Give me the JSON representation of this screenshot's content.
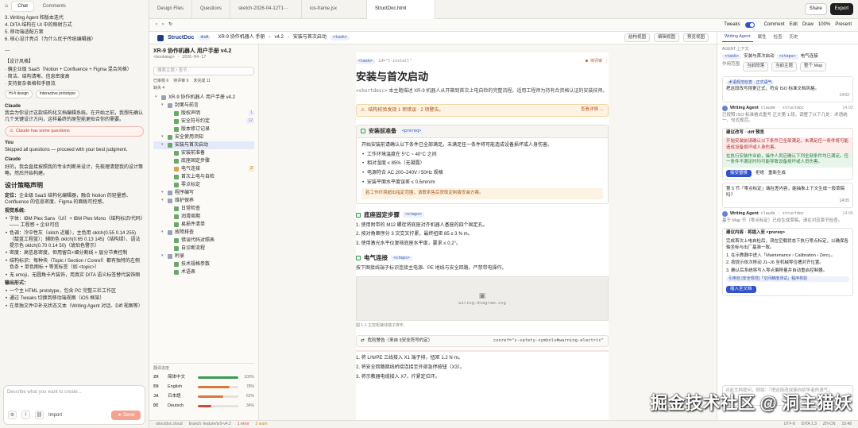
{
  "chat": {
    "tabs": [
      "Chat",
      "Comments"
    ],
    "lines_top": [
      "3. Writing Agent 和版本迭代",
      "4. DITA 结构在 UI 中的映射方式",
      "5. 移动端适配方案",
      "6. 核心设计亮点（为什么优于传统编辑器）"
    ],
    "ellipsis": "---",
    "style_title": "【设计风格】",
    "style_items": [
      "· 偏企业级 SaaS（Notion + Confluence + Figma 混合风格）",
      "· 简洁、结构清晰、信息密度高",
      "· 支持复杂表格和手册流"
    ],
    "chips": [
      "Hi-fi design",
      "Interactive prototype"
    ],
    "claude_label": "Claude",
    "claude_text": "我会为你设计这款结构化文档编辑系统。在开始之前，我想先确认几个关键设计方向，这样最终的原型能更贴合你的需要。",
    "warn_chip": "Claude has some questions",
    "you_label": "You",
    "you_text": "Skipped all questions — proceed with your best judgment.",
    "claude2_label": "Claude",
    "claude2_text": "好的，我会直接按照我的专业判断来设计，先梳理清楚我的设计策略，然后开始构建。",
    "h_strategy": "设计策略声明",
    "pos_label": "定位：",
    "pos_text": "企业级 SaaS 结构化编辑器，融合 Notion 的轻量感、Confluence 的信息密度、Figma 的面板可控感。",
    "visual_label": "视觉系统:",
    "visual_items": [
      "字体：IBM Plex Sans（UI）+ IBM Plex Mono（结构标识/代码）—— 工程感 + 企业可信",
      "色调：冷中性灰（oklch 近暖），主色用 oklch(0.55 0.14 255)（靛蓝工程蓝）；辅助色 oklch(0.65 0.13 145)（结构绿）、语法提示色 oklch(0.70 0.14 50)（琥珀色警示）",
      "密度：高信息密度，但用留白+细分割线 + 层分节奏控制",
      "结构标识：每种块（Topic / Section / Conref）都有独特的左侧色条 + 单色图标 + 等宽标签（如 <topic>）",
      "无 emoji，无圆角卡片装饰，用真实 DITA 语义标签替代装饰图"
    ],
    "h_output": "输出形式：",
    "output_items": [
      "一个主 HTML prototype，包含 PC 完整三栏工作区",
      "通过 Tweaks 切换到移动端视图（iOS 框架）",
      "在单独文件中补充状态文本（Writing Agent 对话、Diff 视图等）"
    ],
    "compose_placeholder": "Describe what you want to create...",
    "import_label": "Import",
    "send_label": "Send"
  },
  "topbar": {
    "tabs": [
      "Design Files",
      "Questions",
      "sketch-2026-04-12T1···",
      "ios-frame.jsx",
      "StructDoc.html"
    ],
    "active_tab": "StructDoc.html",
    "tweaks_label": "Tweaks",
    "comment_label": "Comment",
    "edit_label": "Edit",
    "draw_label": "Draw",
    "zoom": "100%",
    "present_label": "Present",
    "share_label": "Share",
    "export_label": "Export"
  },
  "header": {
    "brand": "StructDoc",
    "brand_tag": "draft",
    "crumbs": [
      "XR-9 协作机器人 手册",
      "v4.2",
      "安装与首次启动"
    ],
    "crumb_tag": "<task>",
    "btns": [
      "结构视图",
      "编辑视图",
      "预览视图"
    ],
    "zh_label": "ZH · 50%",
    "save_label": "发布"
  },
  "tree": {
    "title": "XR-9 协作机器人 用户手册 v4.2",
    "subtitle": "<bookmap> · 2026-04-17",
    "search_placeholder": "搜索主题 / 查节...",
    "stats": [
      "已审核 6",
      "待评审 9",
      "未完成 11",
      "缺失 4"
    ],
    "nodes": [
      {
        "label": "XR-9 协作机器人 用户手册 v4.2",
        "lvl": 0,
        "ic": "gr"
      },
      {
        "label": "封面与前言",
        "lvl": 1,
        "ic": "gr"
      },
      {
        "label": "版权声明",
        "lvl": 2,
        "ic": "g",
        "cnt": "1"
      },
      {
        "label": "安全符号约定",
        "lvl": 2,
        "ic": "g",
        "cnt": "12"
      },
      {
        "label": "版本修订记录",
        "lvl": 2,
        "ic": "g"
      },
      {
        "label": "安全使用须知",
        "lvl": 1,
        "ic": "g"
      },
      {
        "label": "安装与首次启动",
        "lvl": 1,
        "ic": "g",
        "sel": true
      },
      {
        "label": "安装前准备",
        "lvl": 2,
        "ic": "g"
      },
      {
        "label": "底座固定步骤",
        "lvl": 2,
        "ic": "g"
      },
      {
        "label": "电气连接",
        "lvl": 2,
        "ic": "y",
        "cnt": "2",
        "warn": true
      },
      {
        "label": "首次上电与自检",
        "lvl": 2,
        "ic": "g"
      },
      {
        "label": "零点标定",
        "lvl": 2,
        "ic": "g"
      },
      {
        "label": "程序编写",
        "lvl": 1,
        "ic": "gr"
      },
      {
        "label": "维护保养",
        "lvl": 1,
        "ic": "gr"
      },
      {
        "label": "日常检查",
        "lvl": 2,
        "ic": "g"
      },
      {
        "label": "润滑周期",
        "lvl": 2,
        "ic": "g"
      },
      {
        "label": "易损件清单",
        "lvl": 2,
        "ic": "g"
      },
      {
        "label": "故障排查",
        "lvl": 1,
        "ic": "gr"
      },
      {
        "label": "错误代码对照表",
        "lvl": 2,
        "ic": "g"
      },
      {
        "label": "自诊断流程",
        "lvl": 2,
        "ic": "g"
      },
      {
        "label": "附录",
        "lvl": 1,
        "ic": "gr"
      },
      {
        "label": "技术规格参数",
        "lvl": 2,
        "ic": "g"
      },
      {
        "label": "术语表",
        "lvl": 2,
        "ic": "g"
      }
    ],
    "lang_title": "翻译进度",
    "langs": [
      {
        "code": "ZH",
        "name": "简体中文",
        "pct": 100,
        "num": "100%",
        "color": "#3b9a53"
      },
      {
        "code": "EN",
        "name": "English",
        "pct": 78,
        "num": "78%",
        "color": "#d57a3a"
      },
      {
        "code": "JA",
        "name": "日本語",
        "pct": 62,
        "num": "62%",
        "color": "#d57a3a"
      },
      {
        "code": "DE",
        "name": "Deutsch",
        "pct": 34,
        "num": "34%",
        "color": "#c94a3a"
      }
    ]
  },
  "doc": {
    "tag": "<task>",
    "id": "id=\"t-install\"",
    "status": "● 待评审 ⋮",
    "title": "安装与首次启动",
    "lead_tag": "<shortdesc>",
    "lead": "本主题描述 XR-9 机器人从开箱到首次上电自检的完整流程。适用工程师为持有合资格认证的安装技师。",
    "alert": "结构校验发现 1 项错误 · 2 项警告。",
    "alert_link": "查看详情 →",
    "card1_title": "安装前准备",
    "card1_tag": "<prereq>",
    "card1_lead": "开始安装前请确认以下条件已全部满足。未满足任一条件将可能造成设备损坏或人身伤害。",
    "card1_items": [
      "工作环境温度在 5°C ~ 40°C 之间",
      "相对湿度 ≤ 85%（无凝露）",
      "电源符合 AC 200–240V / 50Hz 规格",
      "安装平面水平度误差 ≤ 0.5mm/m"
    ],
    "card1_note": "若工作环境超出指定范围，请联系售后获取定制版安装方案。",
    "s2_title": "底座固定步骤",
    "s2_tag": "<steps>",
    "s2_items": [
      "1. 使用附带的 M12 螺栓将底座对齐机器人基座的四个固定孔。",
      "2. 按对角顺序分 3 次交叉拧紧，最终扭矩 85 ± 3 N·m。",
      "3. 使用激光水平仪复核底座水平度，要求 ≤ 0.2°。"
    ],
    "s3_title": "电气连接",
    "s3_tag": "<steps>",
    "s3_lead": "按下图接线端子标识连接主电源、PE 地线与安全回路。严禁带电操作。",
    "img_name": "wiring-diagram.svg",
    "img_caption": "图 1-1 主控柜接线端子排布",
    "warn_text": "危险警告（来自 §安全符号约定）",
    "warn_code": "conref=\"s-safety-symbols#warning-electric\"",
    "s3_items": [
      "1. 将 L/N/PE 三线接入 X1 端子排，扭矩 1.2 N·m。",
      "2. 将安全回路跳线桥接连接至外部急停按钮（X3）。",
      "3. 将示教器电缆接入 X7，拧紧定位环。"
    ]
  },
  "right": {
    "tabs": [
      "Writing Agent",
      "属性",
      "检查",
      "历史"
    ],
    "agent_tag": "AGENT 上下文",
    "agent_ctx": [
      "<task>",
      "安装与首次启动",
      "<steps>",
      "电气连接"
    ],
    "scope_label": "作用范围",
    "scope_opts": [
      "当前段落",
      "当前主题",
      "整个 Map"
    ],
    "chip_note": "术语规范检查 · 正式语气",
    "m1_text": "把这段改写得更正式，符合 ISO 标准文档风格。",
    "m1_time": "14:02",
    "m2_who": "Writing Agent",
    "m2_meta": "claude · structdoc",
    "m2_time": "14:02",
    "m2_text": "已按照 ISO 标准格式重写 正文第 1 段，调整了以下几处：术语统一、句式规范。",
    "diff_title": "建议改写 · diff 预览",
    "diff_del": "开始安装前请确认以下条件已全部满足。未满足任一条件将可能造成设备损坏或人身伤害。",
    "diff_add": "在执行安装作业前，操作人员应确认下列全部条件均已满足。任一条件不满足时均可能导致设备损坏或人员伤害。",
    "accept_label": "接受替换",
    "reject_label": "拒绝",
    "retry_label": "重新生成",
    "m3_text": "第 5 节「零点标定」端在差内容，能抽象上下文生成一段草稿吗？",
    "m3_time": "14:05",
    "m4_who": "Writing Agent",
    "m4_meta": "claude · structdoc",
    "m4_time": "14:05",
    "m4_text": "基于 Map 节（零点标定）已经生成草稿，请在对应章节检查。",
    "draft_title": "建议内容 · 将插入至 <prereq>",
    "draft_text": "完成首次上电自检后，须在空载状态下执行零点标定，以确保各轴坐标与出厂基准一致。",
    "draft_items": [
      "1. 在示教器中进入「Maintenance › Calibration › Zero」。",
      "2. 按提示依次移动 J1–J6 至机械零位槽对齐位置。",
      "3. 确认后系统将写入零点偏移量并自动重启控制器。"
    ],
    "draft_note": "引用自 [安全规范]「空间精度测试」程序校验",
    "insert_label": "插入至文档",
    "input_placeholder": "对此文档提问，例如：「把这段改成面向初学者的语气」"
  },
  "status": {
    "items": [
      "structdoc.cloud",
      "branch: feature/xr9-v4.2",
      "1 error",
      "2 warn"
    ],
    "right_items": [
      "UTF-8",
      "DITA 1.3",
      "ZH-CN",
      "10:48"
    ]
  },
  "watermark": "掘金技术社区 @ 洞主猫妖"
}
